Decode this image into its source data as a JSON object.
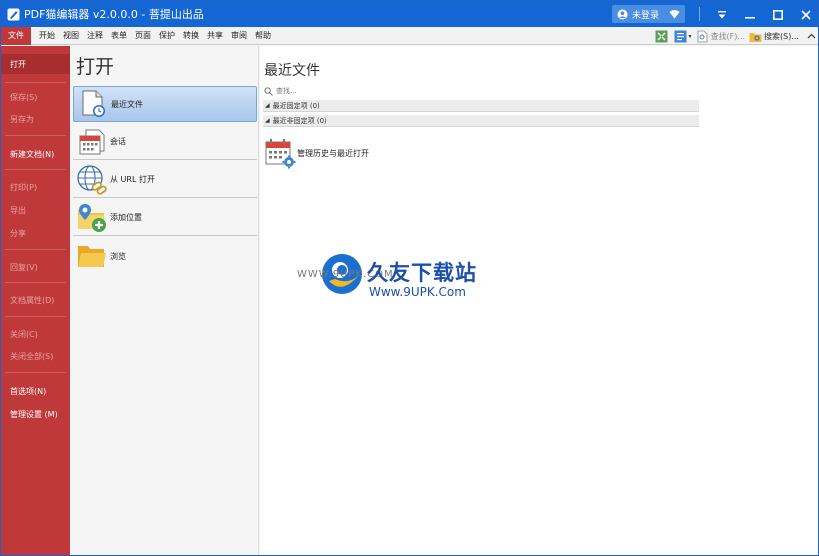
{
  "window": {
    "title": "PDF猫编辑器 v2.0.0.0 - 菩提山出品",
    "user_label": "未登录"
  },
  "menu": {
    "items": [
      "文件",
      "开始",
      "视图",
      "注释",
      "表单",
      "页面",
      "保护",
      "转换",
      "共享",
      "审阅",
      "帮助"
    ],
    "active_index": 0,
    "tools": {
      "find_label": "查找(F)...",
      "search_label": "搜索(S)..."
    }
  },
  "sidebar": {
    "items": [
      {
        "label": "打开",
        "state": "selected"
      },
      {
        "label": "保存(S)",
        "state": "disabled"
      },
      {
        "label": "另存为",
        "state": "disabled"
      },
      {
        "label": "新建文档(N)",
        "state": "enabled"
      },
      {
        "label": "打印(P)",
        "state": "disabled"
      },
      {
        "label": "导出",
        "state": "disabled"
      },
      {
        "label": "分享",
        "state": "disabled"
      },
      {
        "label": "回复(V)",
        "state": "disabled"
      },
      {
        "label": "文档属性(D)",
        "state": "disabled"
      },
      {
        "label": "关闭(C)",
        "state": "disabled"
      },
      {
        "label": "关闭全部(S)",
        "state": "disabled"
      },
      {
        "label": "首选项(N)",
        "state": "enabled"
      },
      {
        "label": "管理设置 (M)",
        "state": "enabled"
      }
    ]
  },
  "open_panel": {
    "title": "打开",
    "options": [
      {
        "label": "最近文件",
        "icon": "recent-files-icon",
        "selected": true
      },
      {
        "label": "会话",
        "icon": "session-icon",
        "selected": false
      },
      {
        "label": "从 URL 打开",
        "icon": "globe-link-icon",
        "selected": false
      },
      {
        "label": "添加位置",
        "icon": "add-location-icon",
        "selected": false
      },
      {
        "label": "浏览",
        "icon": "folder-icon",
        "selected": false
      }
    ]
  },
  "recent_panel": {
    "title": "最近文件",
    "search_placeholder": "查找...",
    "groups": [
      {
        "label": "最近固定项 (0)"
      },
      {
        "label": "最近非固定项 (0)"
      }
    ],
    "manage_label": "管理历史与最近打开"
  },
  "watermark": {
    "left_text": "WWW.9UPK.COM",
    "main_text": "久友下载站",
    "url_text": "Www.9UPK.Com"
  },
  "colors": {
    "titlebar": "#1467d3",
    "sidebar": "#c0393a",
    "selected_option": "#a9c6ea"
  }
}
